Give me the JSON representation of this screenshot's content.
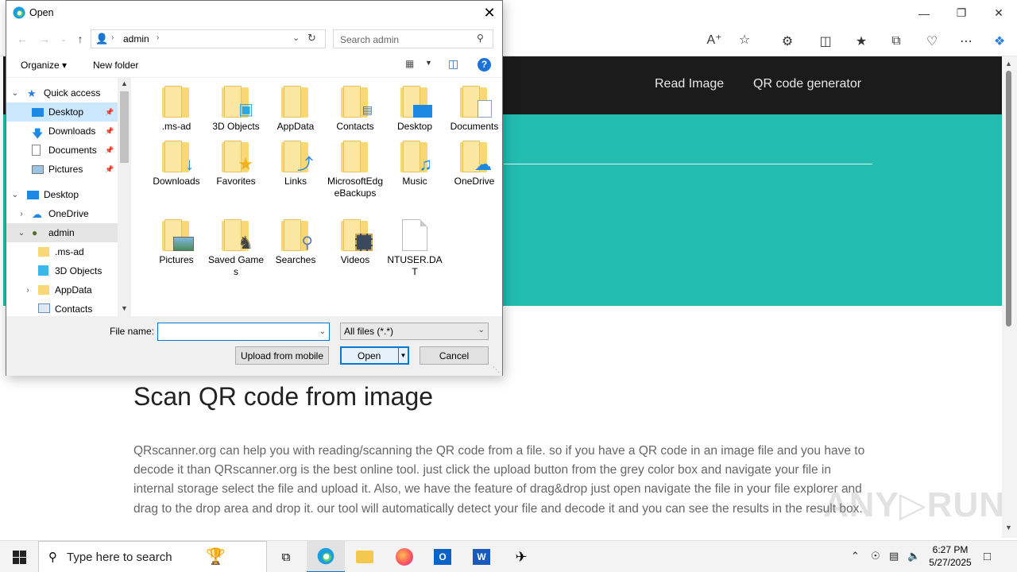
{
  "browser": {
    "nav_links": [
      "Read Image",
      "QR code generator"
    ],
    "heading": "Scan QR code from image",
    "paragraph": "QRscanner.org can help you with reading/scanning the QR code from a file. so if you have a QR code in an image file and you have to decode it than QRscanner.org is the best online tool. just click the upload button from the grey color box and navigate your file in internal storage select the file and upload it. Also, we have the feature of drag&drop just open navigate the file in your file explorer and drag to the drop area and drop it. our tool will automatically detect your file and decode it and you can see the results in the result box.",
    "hero_color": "#22bdb0",
    "nav_color": "#1b1b1b"
  },
  "dialog": {
    "title": "Open",
    "path": [
      "admin"
    ],
    "search_placeholder": "Search admin",
    "organize_label": "Organize ▾",
    "new_folder_label": "New folder",
    "tree": [
      {
        "label": "Quick access",
        "icon": "star-icon",
        "expanded": true,
        "indent": 0
      },
      {
        "label": "Desktop",
        "icon": "desktop-icon",
        "pinned": true,
        "indent": 1,
        "selected": true
      },
      {
        "label": "Downloads",
        "icon": "download-icon",
        "pinned": true,
        "indent": 1
      },
      {
        "label": "Documents",
        "icon": "document-icon",
        "pinned": true,
        "indent": 1
      },
      {
        "label": "Pictures",
        "icon": "pictures-icon",
        "pinned": true,
        "indent": 1
      },
      {
        "label": "Desktop",
        "icon": "desktop-icon",
        "expanded": true,
        "indent": 0
      },
      {
        "label": "OneDrive",
        "icon": "cloud-icon",
        "collapsed": true,
        "indent": 1
      },
      {
        "label": "admin",
        "icon": "user-icon",
        "expanded": true,
        "indent": 1,
        "hover": true
      },
      {
        "label": ".ms-ad",
        "icon": "folder-icon",
        "indent": 2
      },
      {
        "label": "3D Objects",
        "icon": "3d-icon",
        "indent": 2
      },
      {
        "label": "AppData",
        "icon": "folder-icon",
        "collapsed": true,
        "indent": 2
      },
      {
        "label": "Contacts",
        "icon": "contacts-icon",
        "indent": 2
      }
    ],
    "files": [
      {
        "name": ".ms-ad",
        "icon": "folder-icon"
      },
      {
        "name": "3D Objects",
        "icon": "3d-objects-icon"
      },
      {
        "name": "AppData",
        "icon": "folder-icon"
      },
      {
        "name": "Contacts",
        "icon": "contacts-folder-icon"
      },
      {
        "name": "Desktop",
        "icon": "desktop-folder-icon"
      },
      {
        "name": "Documents",
        "icon": "documents-folder-icon"
      },
      {
        "name": "Downloads",
        "icon": "downloads-folder-icon"
      },
      {
        "name": "Favorites",
        "icon": "favorites-folder-icon"
      },
      {
        "name": "Links",
        "icon": "links-folder-icon"
      },
      {
        "name": "MicrosoftEdgeBackups",
        "icon": "folder-icon"
      },
      {
        "name": "Music",
        "icon": "music-folder-icon"
      },
      {
        "name": "OneDrive",
        "icon": "onedrive-folder-icon"
      },
      {
        "name": "Pictures",
        "icon": "pictures-folder-icon"
      },
      {
        "name": "Saved Games",
        "icon": "saved-games-folder-icon"
      },
      {
        "name": "Searches",
        "icon": "searches-folder-icon"
      },
      {
        "name": "Videos",
        "icon": "videos-folder-icon"
      },
      {
        "name": "NTUSER.DAT",
        "icon": "file-icon"
      }
    ],
    "file_name_label": "File name:",
    "file_name_value": "",
    "filter_value": "All files (*.*)",
    "upload_mobile_label": "Upload from mobile",
    "open_label": "Open",
    "cancel_label": "Cancel"
  },
  "taskbar": {
    "search_placeholder": "Type here to search",
    "time": "6:27 PM",
    "date": "5/27/2025"
  }
}
